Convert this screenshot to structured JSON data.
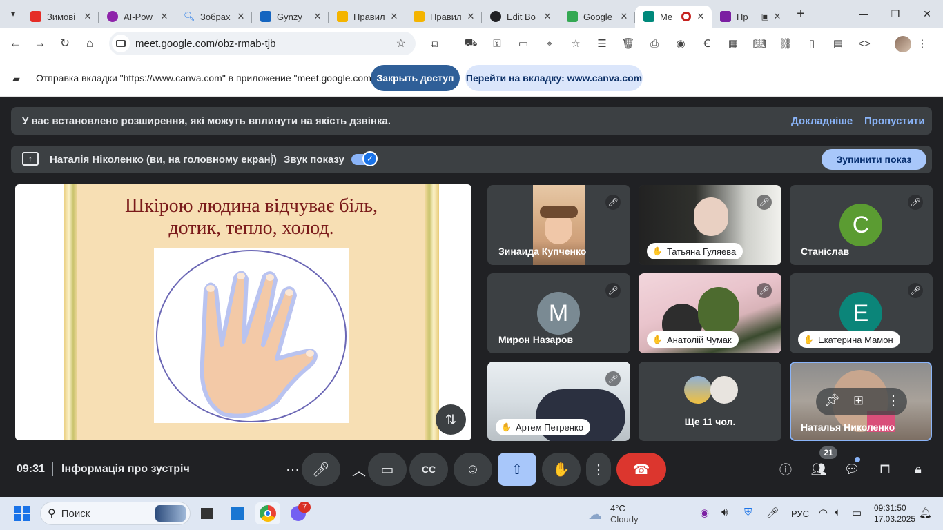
{
  "browser": {
    "tabs": [
      {
        "title": "Зимові",
        "color": "#e52d27"
      },
      {
        "title": "AI-Pow",
        "color": "#8e24aa"
      },
      {
        "title": "Зобрах",
        "color": "#1a73e8"
      },
      {
        "title": "Gynzy",
        "color": "#1565c0"
      },
      {
        "title": "Правил",
        "color": "#f4b400"
      },
      {
        "title": "Правил",
        "color": "#f4b400"
      },
      {
        "title": "Edit Bo",
        "color": "#202124"
      },
      {
        "title": "Google",
        "color": "#34a853"
      },
      {
        "title": "Me",
        "color": "#00897b",
        "active": true
      },
      {
        "title": "Пр",
        "color": "#7b1fa2"
      }
    ],
    "url": "meet.google.com/obz-rmab-tjb"
  },
  "castbar": {
    "message": "Отправка вкладки \"https://www.canva.com\" в приложение \"meet.google.com\"...",
    "close_label": "Закрыть доступ",
    "goto_label": "Перейти на вкладку: www.canva.com"
  },
  "warning": {
    "text": "У вас встановлено розширення, які можуть вплинути на якість дзвінка.",
    "more_label": "Докладніше",
    "skip_label": "Пропустити"
  },
  "presenting": {
    "who": "Наталія Ніколенко (ви, на головному екрані)",
    "sound_label": "Звук показу",
    "sound_on": true,
    "stop_label": "Зупинити показ"
  },
  "slide": {
    "title_line1": "Шкірою людина відчуває біль,",
    "title_line2": "дотик, тепло, холод."
  },
  "tiles": [
    {
      "name": "Зинаида Купченко",
      "kind": "video",
      "muted": true
    },
    {
      "name": "Татьяна Гуляева",
      "kind": "video",
      "hand": true,
      "muted": true
    },
    {
      "name": "Станіслав",
      "kind": "avatar",
      "initial": "С",
      "color": "#5b9c32",
      "muted": true
    },
    {
      "name": "Мирон Назаров",
      "kind": "avatar",
      "initial": "М",
      "color": "#7a8a93",
      "muted": true
    },
    {
      "name": "Анатолій Чумак",
      "kind": "video",
      "hand": true,
      "muted": true
    },
    {
      "name": "Екатерина Мамон",
      "kind": "avatar",
      "initial": "Е",
      "color": "#0b8579",
      "hand": true,
      "muted": true
    },
    {
      "name": "Артем Петренко",
      "kind": "video",
      "hand": true,
      "muted": true
    },
    {
      "name": "Ще 11 чол.",
      "kind": "more"
    },
    {
      "name": "Наталья Николенко",
      "kind": "self"
    }
  ],
  "controls": {
    "time": "09:31",
    "meeting_info": "Інформація про зустріч",
    "participants_count": "21"
  },
  "taskbar": {
    "search_placeholder": "Поиск",
    "weather_temp": "4°C",
    "weather_desc": "Cloudy",
    "lang": "РУС",
    "time": "09:31:50",
    "date": "17.03.2025",
    "badge": "7"
  }
}
